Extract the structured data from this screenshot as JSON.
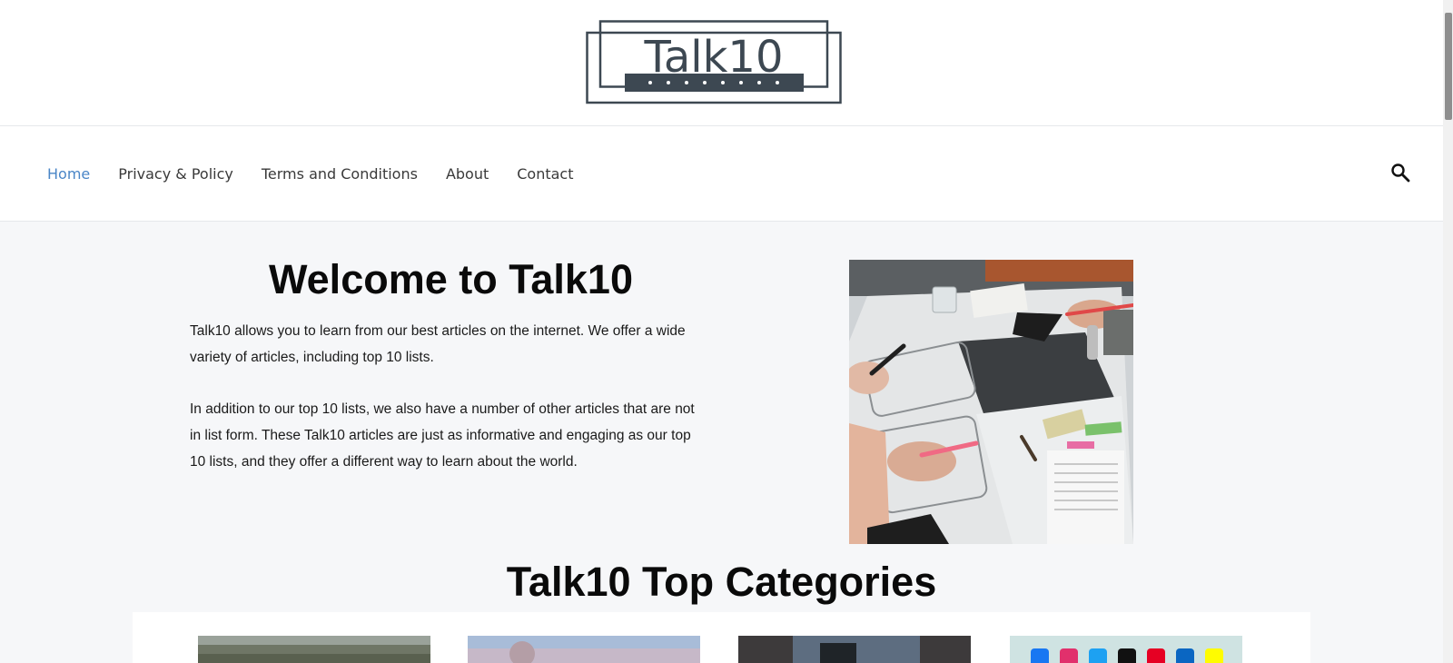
{
  "header": {
    "logo_text": "Talk10"
  },
  "nav": {
    "items": [
      {
        "label": "Home",
        "active": true
      },
      {
        "label": "Privacy & Policy",
        "active": false
      },
      {
        "label": "Terms and Conditions",
        "active": false
      },
      {
        "label": "About",
        "active": false
      },
      {
        "label": "Contact",
        "active": false
      }
    ],
    "search_icon": "search-icon"
  },
  "hero": {
    "title": "Welcome to Talk10",
    "paragraphs": [
      "Talk10 allows you to learn from our best articles on the internet. We offer a wide variety of articles, including top 10 lists.",
      "In addition to our top 10 lists, we also have a number of other articles that are not in list form. These Talk10 articles are just as informative and engaging as our top 10 lists, and they offer a different way to learn about the world."
    ]
  },
  "categories": {
    "title": "Talk10 Top Categories",
    "social_icons": [
      "facebook-icon",
      "instagram-icon",
      "twitter-icon",
      "tiktok-icon",
      "pinterest-icon",
      "linkedin-icon",
      "snapchat-icon"
    ]
  },
  "colors": {
    "nav_active": "#4a86c7",
    "logo": "#3d4852"
  }
}
